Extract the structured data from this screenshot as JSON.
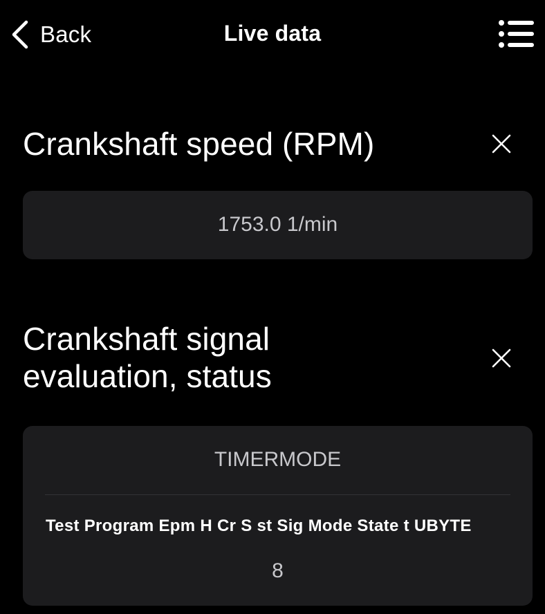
{
  "header": {
    "back_label": "Back",
    "title": "Live data",
    "back_icon": "chevron-left-icon",
    "menu_icon": "list-menu-icon"
  },
  "parameters": [
    {
      "title": "Crankshaft speed (RPM)",
      "value": "1753.0 1/min",
      "close_icon": "close-icon"
    },
    {
      "title_line1": "Crankshaft signal",
      "title_line2": "evaluation, status",
      "value": "TIMERMODE",
      "detail_label": "Test Program Epm H Cr S st Sig Mode State t UBYTE",
      "detail_value": "8",
      "close_icon": "close-icon"
    }
  ],
  "colors": {
    "background": "#000000",
    "card": "#1c1c1e",
    "value_text": "#c8c8cc",
    "primary_text": "#ffffff"
  }
}
